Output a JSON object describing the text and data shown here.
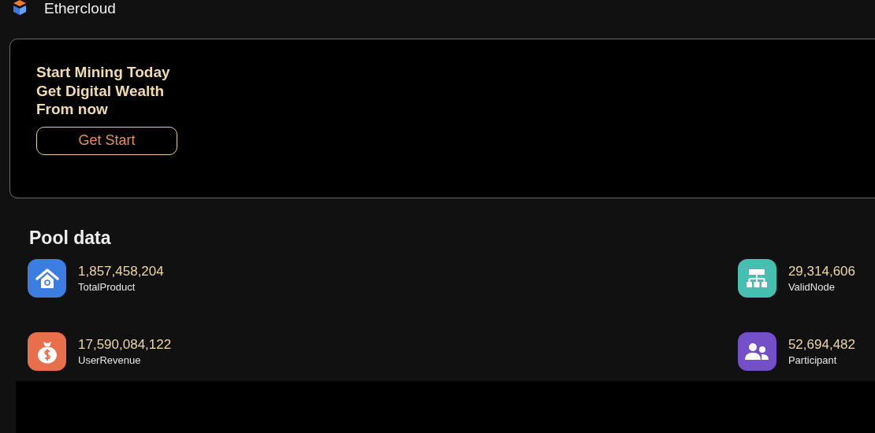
{
  "header": {
    "brand": "Ethercloud"
  },
  "banner": {
    "lines": [
      "Start Mining Today",
      "Get Digital Wealth",
      "From now"
    ],
    "button": "Get Start"
  },
  "pool": {
    "title": "Pool data",
    "stats": [
      {
        "kind": "house",
        "color": "#3b7de0",
        "value": "1,857,458,204",
        "label": "TotalProduct"
      },
      {
        "kind": "network",
        "color": "#45bfb0",
        "value": "29,314,606",
        "label": "ValidNode"
      },
      {
        "kind": "moneybag",
        "color": "#e86f4c",
        "value": "17,590,084,122",
        "label": "UserRevenue"
      },
      {
        "kind": "people",
        "color": "#7350c8",
        "value": "52,694,482",
        "label": "Participant"
      }
    ]
  }
}
